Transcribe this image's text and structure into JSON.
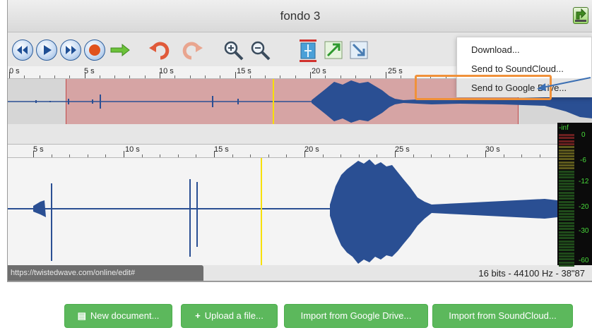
{
  "editor": {
    "title": "fondo 3",
    "status_url": "https://twistedwave.com/online/edit#",
    "status_info": "16 bits - 44100 Hz - 38\"87"
  },
  "toolbar": {
    "buttons": [
      "rewind-icon",
      "play-icon",
      "fast-forward-icon",
      "record-icon",
      "go-arrow-icon",
      "undo-icon",
      "redo-icon",
      "zoom-in-icon",
      "zoom-out-icon",
      "fit-height-icon",
      "grow-icon",
      "shrink-icon"
    ]
  },
  "overview_ruler": {
    "labels": [
      "0 s",
      "5 s",
      "10 s",
      "15 s",
      "20 s",
      "25 s"
    ]
  },
  "main_ruler": {
    "labels": [
      "5 s",
      "10 s",
      "15 s",
      "20 s",
      "25 s",
      "30 s"
    ]
  },
  "meter": {
    "labels": [
      "-inf",
      "0",
      "-6",
      "-12",
      "-20",
      "-30",
      "-60"
    ]
  },
  "menu": {
    "items": [
      "Download...",
      "Send to SoundCloud...",
      "Send to Google Drive..."
    ]
  },
  "actions": {
    "new_document": "New document...",
    "upload_file": "Upload a file...",
    "import_google": "Import from Google Drive...",
    "import_soundcloud": "Import from SoundCloud..."
  },
  "colors": {
    "waveform": "#2a4f93",
    "selection": "#d66060",
    "cursor": "#f7e000",
    "highlight": "#f0913a",
    "action_button": "#5cb85c"
  }
}
